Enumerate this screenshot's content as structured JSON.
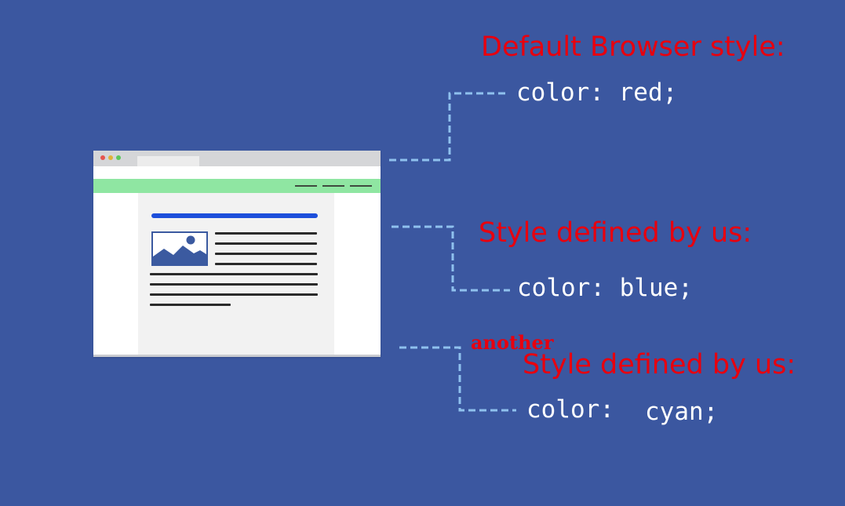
{
  "colors": {
    "background": "#3b57a0",
    "heading_text": "#e8000e",
    "code_text": "#ffffff",
    "connector": "#8fc1ee",
    "navbar_green": "#8fe6a2",
    "headline_bar_blue": "#1d4fdb",
    "traffic_red": "#e5554f",
    "traffic_yellow": "#e0b33a",
    "traffic_green": "#5cc85c"
  },
  "browser_illustration": {
    "icon": "web-page-illustration-icon",
    "image_placeholder_icon": "image-placeholder-icon"
  },
  "rules": [
    {
      "heading": "Default Browser style:",
      "declaration": "color: red;"
    },
    {
      "heading": "Style defined by us:",
      "declaration": "color: blue;"
    },
    {
      "prefix": "another",
      "heading": "Style defined by us:",
      "declaration_property": "color:",
      "declaration_value": "cyan;"
    }
  ]
}
